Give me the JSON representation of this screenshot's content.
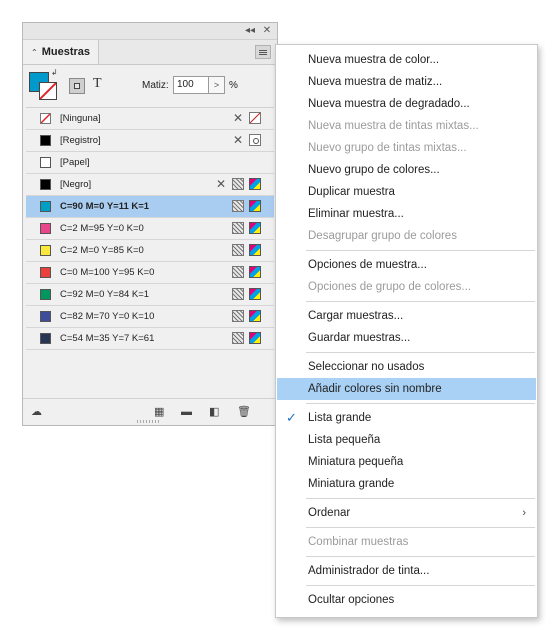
{
  "panel": {
    "tab_title": "Muestras",
    "tint_label": "Matiz:",
    "tint_value": "100",
    "tint_unit": "%",
    "fill_color": "#0099cc",
    "swatches": [
      {
        "label": "[Ninguna]",
        "color": "none"
      },
      {
        "label": "[Registro]",
        "color": "#000000"
      },
      {
        "label": "[Papel]",
        "color": "#ffffff"
      },
      {
        "label": "[Negro]",
        "color": "#000000"
      },
      {
        "label": "C=90 M=0 Y=11 K=1",
        "color": "#00a0c6",
        "selected": true
      },
      {
        "label": "C=2 M=95 Y=0 K=0",
        "color": "#e8458b"
      },
      {
        "label": "C=2 M=0 Y=85 K=0",
        "color": "#fae83c"
      },
      {
        "label": "C=0 M=100 Y=95 K=0",
        "color": "#e8403a"
      },
      {
        "label": "C=92 M=0 Y=84 K=1",
        "color": "#00965e"
      },
      {
        "label": "C=82 M=70 Y=0 K=10",
        "color": "#3e4c9a"
      },
      {
        "label": "C=54 M=35 Y=7 K=61",
        "color": "#283553"
      }
    ]
  },
  "menu": {
    "items": [
      {
        "label": "Nueva muestra de color..."
      },
      {
        "label": "Nueva muestra de matiz..."
      },
      {
        "label": "Nueva muestra de degradado..."
      },
      {
        "label": "Nueva muestra de tintas mixtas..."
      },
      {
        "label": "Nuevo grupo de tintas mixtas..."
      },
      {
        "label": "Nuevo grupo de colores..."
      },
      {
        "label": "Duplicar muestra"
      },
      {
        "label": "Eliminar muestra..."
      },
      {
        "label": "Desagrupar grupo de colores"
      },
      {
        "label": "Opciones de muestra..."
      },
      {
        "label": "Opciones de grupo de colores..."
      },
      {
        "label": "Cargar muestras..."
      },
      {
        "label": "Guardar muestras..."
      },
      {
        "label": "Seleccionar no usados"
      },
      {
        "label": "Añadir colores sin nombre"
      },
      {
        "label": "Lista grande"
      },
      {
        "label": "Lista pequeña"
      },
      {
        "label": "Miniatura pequeña"
      },
      {
        "label": "Miniatura grande"
      },
      {
        "label": "Ordenar"
      },
      {
        "label": "Combinar muestras"
      },
      {
        "label": "Administrador de tinta..."
      },
      {
        "label": "Ocultar opciones"
      }
    ],
    "highlight_color": "#a9d1f5"
  }
}
